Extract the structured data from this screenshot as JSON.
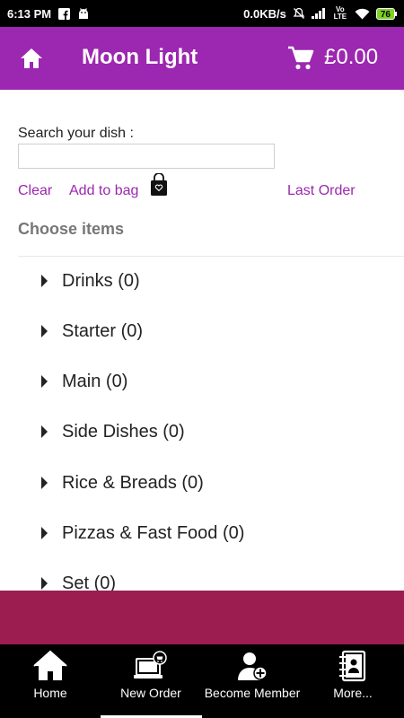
{
  "status_bar": {
    "time": "6:13 PM",
    "network_speed": "0.0KB/s",
    "volte": "Vo LTE",
    "battery": "76",
    "icons": [
      "facebook-icon",
      "android-icon",
      "mute-icon",
      "signal-icon",
      "wifi-icon",
      "battery-icon"
    ]
  },
  "app_bar": {
    "title": "Moon Light",
    "cart_total": "£0.00",
    "background": "#9c27b0"
  },
  "search": {
    "label": "Search your dish :",
    "value": "",
    "placeholder": ""
  },
  "actions": {
    "clear": "Clear",
    "add_to_bag": "Add to bag",
    "last_order": "Last Order",
    "link_color": "#9c27b0"
  },
  "menu": {
    "heading": "Choose items",
    "categories": [
      {
        "label": "Drinks (0)"
      },
      {
        "label": "Starter (0)"
      },
      {
        "label": "Main (0)"
      },
      {
        "label": "Side Dishes (0)"
      },
      {
        "label": "Rice & Breads (0)"
      },
      {
        "label": "Pizzas & Fast Food (0)"
      },
      {
        "label": "Set (0)"
      }
    ]
  },
  "footer_band_color": "#9c1d50",
  "bottom_nav": {
    "items": [
      {
        "label": "Home",
        "icon": "home-icon"
      },
      {
        "label": "New Order",
        "icon": "new-order-icon"
      },
      {
        "label": "Become Member",
        "icon": "add-member-icon"
      },
      {
        "label": "More...",
        "icon": "contacts-book-icon"
      }
    ],
    "active": "New Order"
  }
}
